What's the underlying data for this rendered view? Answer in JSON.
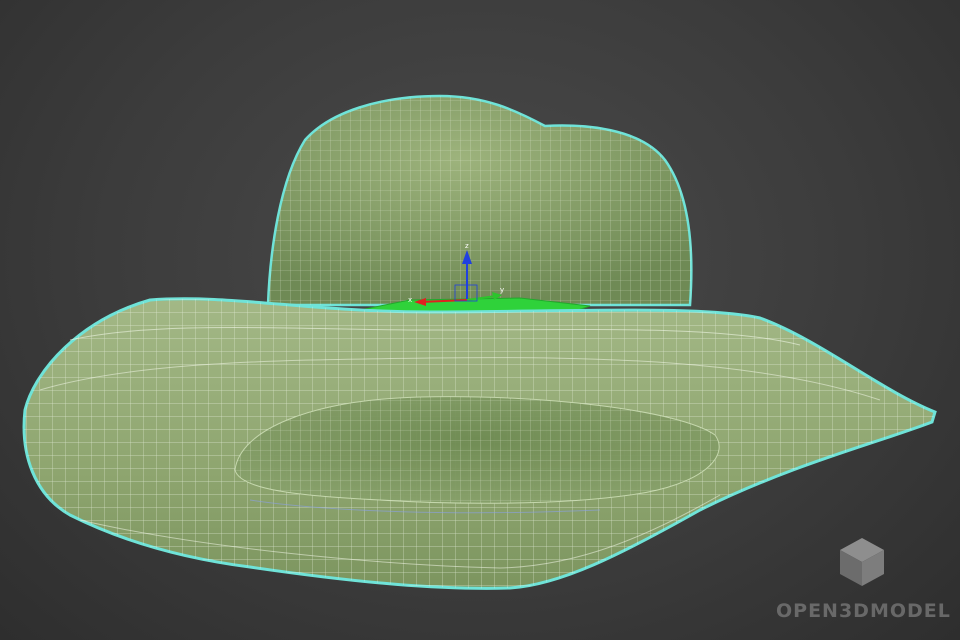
{
  "viewport": {
    "background_color": "#3c3c3c",
    "object": {
      "name": "hat",
      "body_color": "#8ea56f",
      "wire_color": "#f0f6e6",
      "selection_outline_color": "#6fe3d8",
      "inner_plane_color": "#2fd23a"
    },
    "gizmo": {
      "x_label": "x",
      "y_label": "y",
      "z_label": "z",
      "x_color": "#e02020",
      "y_color": "#2cc52c",
      "z_color": "#2040e0"
    }
  },
  "watermark": {
    "text": "OPEN3DMODEL",
    "icon": "cube-icon"
  }
}
